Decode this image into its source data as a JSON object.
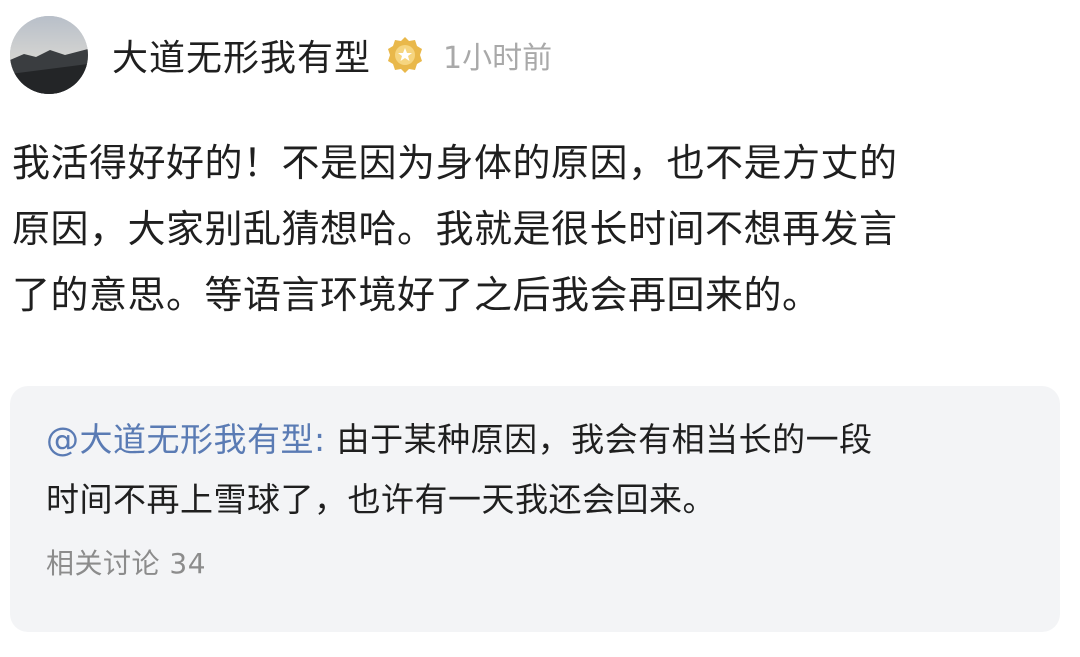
{
  "post": {
    "author": "大道无形我有型",
    "time": "1小时前",
    "body_lines": [
      "我活得好好的！不是因为身体的原因，也不是方丈的",
      "原因，大家别乱猜想哈。我就是很长时间不想再发言",
      "了的意思。等语言环境好了之后我会再回来的。"
    ]
  },
  "quote": {
    "author": "@大道无形我有型:",
    "text_line1": " 由于某种原因，我会有相当长的一段",
    "text_line2": "时间不再上雪球了，也许有一天我还会回来。",
    "related_label": "相关讨论 34"
  },
  "colors": {
    "mention": "#5a7bb4",
    "badge_gold": "#e9b84a",
    "card_bg": "#f3f4f6"
  },
  "icons": {
    "avatar": "avatar",
    "badge": "verified-badge-icon"
  }
}
